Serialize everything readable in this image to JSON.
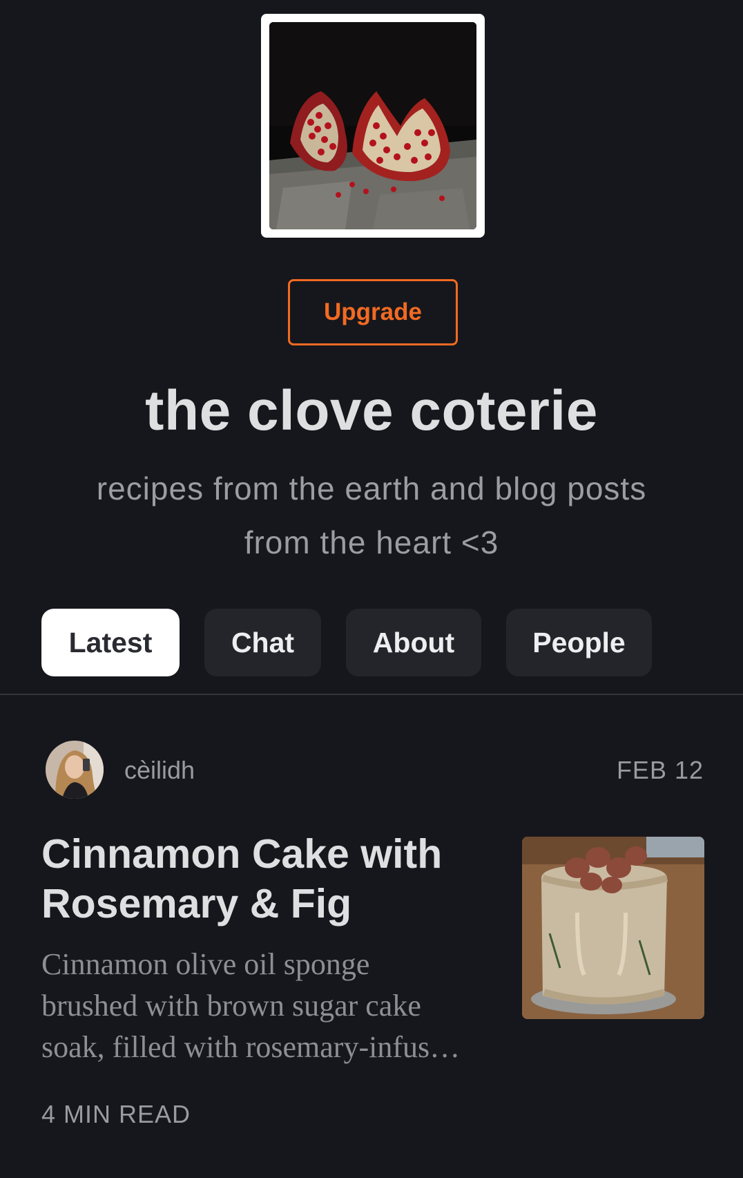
{
  "publication": {
    "logo_icon": "pomegranate-logo",
    "upgrade_label": "Upgrade",
    "title": "the clove coterie",
    "subtitle_line1": "recipes from the earth and blog posts",
    "subtitle_line2": "from the heart <3"
  },
  "tabs": [
    {
      "label": "Latest",
      "active": true
    },
    {
      "label": "Chat",
      "active": false
    },
    {
      "label": "About",
      "active": false
    },
    {
      "label": "People",
      "active": false
    }
  ],
  "post": {
    "author": "cèilidh",
    "date": "FEB 12",
    "title_line1": "Cinnamon Cake with",
    "title_line2": "Rosemary & Fig",
    "excerpt_line1": "Cinnamon olive oil sponge",
    "excerpt_line2": "brushed with brown sugar cake",
    "excerpt_line3": "soak, filled with rosemary-infus…",
    "read_time": "4 MIN READ"
  },
  "colors": {
    "background": "#16171c",
    "accent": "#f26a23",
    "tab_bg": "#24252b",
    "tab_active_bg": "#ffffff"
  }
}
